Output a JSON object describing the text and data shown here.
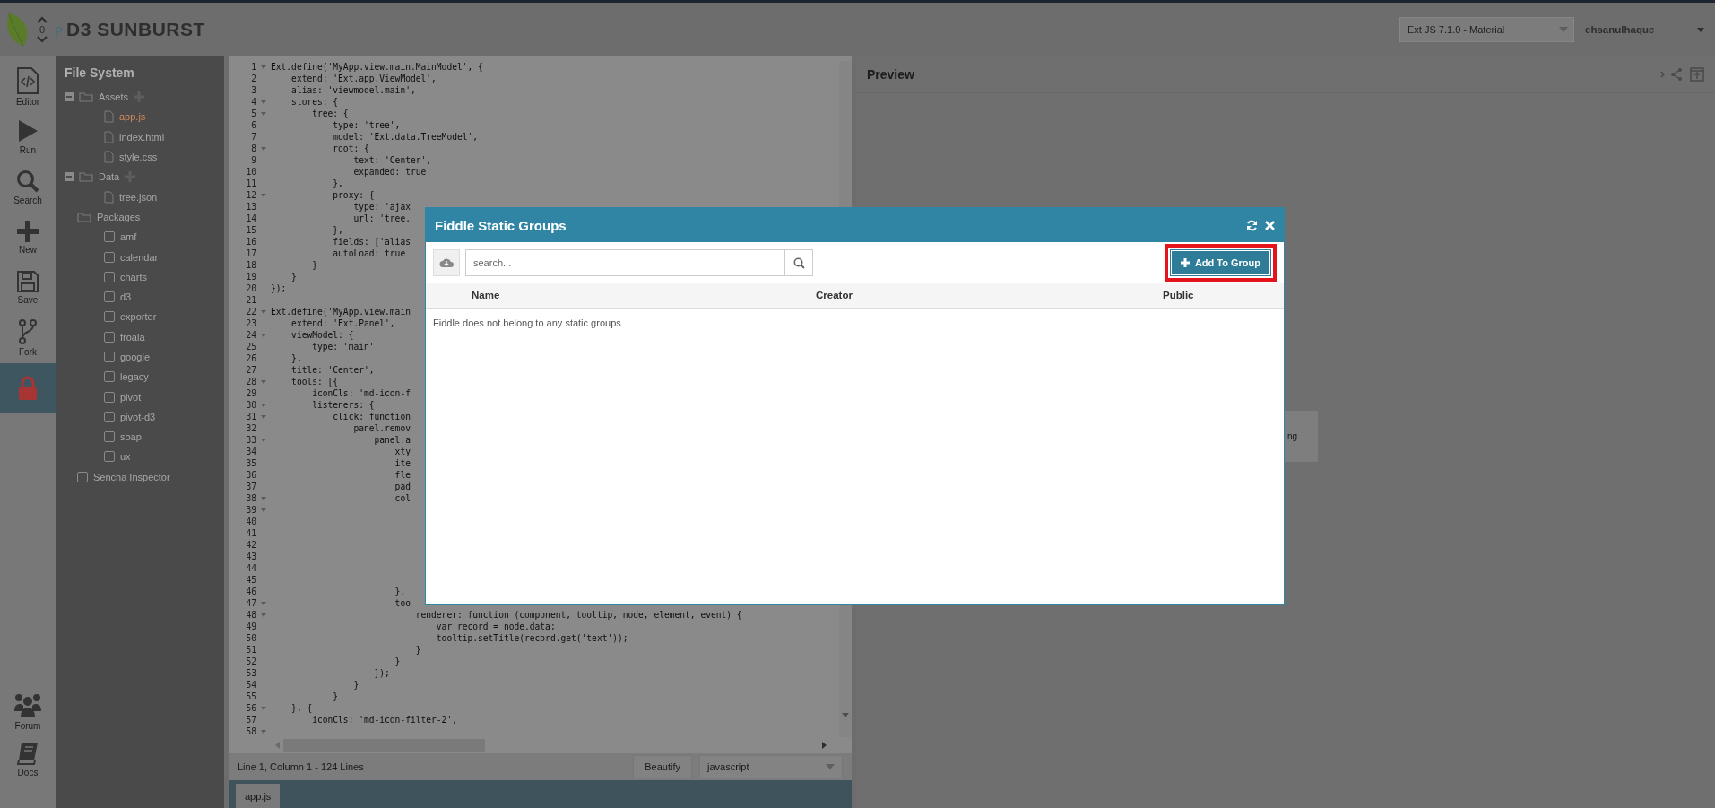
{
  "header": {
    "vote_count": "0",
    "title": "D3 SUNBURST",
    "framework_select": "Ext JS 7.1.0 - Material",
    "user": "ehsanulhaque"
  },
  "nav": {
    "items": [
      {
        "kind": "editor",
        "label": "Editor",
        "selected": false
      },
      {
        "kind": "run",
        "label": "Run",
        "selected": false
      },
      {
        "kind": "search",
        "label": "Search",
        "selected": false
      },
      {
        "kind": "new",
        "label": "New",
        "selected": false
      },
      {
        "kind": "save",
        "label": "Save",
        "selected": false
      },
      {
        "kind": "fork",
        "label": "Fork",
        "selected": false
      },
      {
        "kind": "lock",
        "selected": true
      }
    ],
    "bottom_items": [
      {
        "kind": "forum",
        "label": "Forum"
      },
      {
        "kind": "docs",
        "label": "Docs"
      }
    ]
  },
  "file_system": {
    "title": "File System",
    "tree": [
      {
        "kind": "folder",
        "label": "Assets",
        "expanded": true,
        "children": [
          {
            "kind": "file",
            "label": "app.js",
            "selected": true
          },
          {
            "kind": "file",
            "label": "index.html",
            "selected": false
          },
          {
            "kind": "file",
            "label": "style.css",
            "selected": false
          }
        ]
      },
      {
        "kind": "folder",
        "label": "Data",
        "expanded": true,
        "children": [
          {
            "kind": "file",
            "label": "tree.json",
            "selected": false
          }
        ]
      },
      {
        "kind": "group",
        "label": "Packages",
        "children": [
          {
            "kind": "package",
            "label": "amf",
            "checked": false
          },
          {
            "kind": "package",
            "label": "calendar",
            "checked": false
          },
          {
            "kind": "package",
            "label": "charts",
            "checked": false
          },
          {
            "kind": "package",
            "label": "d3",
            "checked": false
          },
          {
            "kind": "package",
            "label": "exporter",
            "checked": false
          },
          {
            "kind": "package",
            "label": "froala",
            "checked": false
          },
          {
            "kind": "package",
            "label": "google",
            "checked": false
          },
          {
            "kind": "package",
            "label": "legacy",
            "checked": false
          },
          {
            "kind": "package",
            "label": "pivot",
            "checked": false
          },
          {
            "kind": "package",
            "label": "pivot-d3",
            "checked": false
          },
          {
            "kind": "package",
            "label": "soap",
            "checked": false
          },
          {
            "kind": "package",
            "label": "ux",
            "checked": false
          }
        ]
      },
      {
        "kind": "package",
        "label": "Sencha Inspector",
        "checked": false
      }
    ]
  },
  "editor": {
    "lines": [
      {
        "number": "1",
        "code": "Ext.define('MyApp.view.main.MainModel', {",
        "foldable": true
      },
      {
        "number": "2",
        "code": "    extend: 'Ext.app.ViewModel',",
        "foldable": false
      },
      {
        "number": "3",
        "code": "    alias: 'viewmodel.main',",
        "foldable": false
      },
      {
        "number": "4",
        "code": "    stores: {",
        "foldable": true
      },
      {
        "number": "5",
        "code": "        tree: {",
        "foldable": true
      },
      {
        "number": "6",
        "code": "            type: 'tree',",
        "foldable": false
      },
      {
        "number": "7",
        "code": "            model: 'Ext.data.TreeModel',",
        "foldable": false
      },
      {
        "number": "8",
        "code": "            root: {",
        "foldable": true
      },
      {
        "number": "9",
        "code": "                text: 'Center',",
        "foldable": false
      },
      {
        "number": "10",
        "code": "                expanded: true",
        "foldable": false
      },
      {
        "number": "11",
        "code": "            },",
        "foldable": false
      },
      {
        "number": "12",
        "code": "            proxy: {",
        "foldable": true
      },
      {
        "number": "13",
        "code": "                type: 'ajax",
        "foldable": false
      },
      {
        "number": "14",
        "code": "                url: 'tree.",
        "foldable": false
      },
      {
        "number": "15",
        "code": "            },",
        "foldable": false
      },
      {
        "number": "16",
        "code": "            fields: ['alias",
        "foldable": false
      },
      {
        "number": "17",
        "code": "            autoLoad: true",
        "foldable": false
      },
      {
        "number": "18",
        "code": "        }",
        "foldable": false
      },
      {
        "number": "19",
        "code": "    }",
        "foldable": false
      },
      {
        "number": "20",
        "code": "});",
        "foldable": false
      },
      {
        "number": "21",
        "foldable": false
      },
      {
        "number": "22",
        "code": "Ext.define('MyApp.view.main",
        "foldable": true
      },
      {
        "number": "23",
        "code": "    extend: 'Ext.Panel',",
        "foldable": false
      },
      {
        "number": "24",
        "code": "    viewModel: {",
        "foldable": true
      },
      {
        "number": "25",
        "code": "        type: 'main'",
        "foldable": false
      },
      {
        "number": "26",
        "code": "    },",
        "foldable": false
      },
      {
        "number": "27",
        "code": "    title: 'Center',",
        "foldable": false
      },
      {
        "number": "28",
        "code": "    tools: [{",
        "foldable": true
      },
      {
        "number": "29",
        "code": "        iconCls: 'md-icon-f",
        "foldable": false
      },
      {
        "number": "30",
        "code": "        listeners: {",
        "foldable": true
      },
      {
        "number": "31",
        "code": "            click: function",
        "foldable": true
      },
      {
        "number": "32",
        "code": "                panel.remov",
        "foldable": false
      },
      {
        "number": "33",
        "code": "                    panel.a",
        "foldable": true
      },
      {
        "number": "34",
        "code": "                        xty",
        "foldable": false
      },
      {
        "number": "35",
        "code": "                        ite",
        "foldable": false
      },
      {
        "number": "36",
        "code": "                        fle",
        "foldable": false
      },
      {
        "number": "37",
        "code": "                        pad",
        "foldable": false
      },
      {
        "number": "38",
        "code": "                        col",
        "foldable": true
      },
      {
        "number": "39",
        "foldable": true
      },
      {
        "number": "40",
        "foldable": false
      },
      {
        "number": "41",
        "foldable": false
      },
      {
        "number": "42",
        "foldable": false
      },
      {
        "number": "43",
        "foldable": false
      },
      {
        "number": "44",
        "foldable": false
      },
      {
        "number": "45",
        "foldable": false
      },
      {
        "number": "46",
        "code": "                        },",
        "foldable": false
      },
      {
        "number": "47",
        "code": "                        too",
        "foldable": true
      },
      {
        "number": "48",
        "code": "                            renderer: function (component, tooltip, node, element, event) {",
        "foldable": true
      },
      {
        "number": "49",
        "code": "                                var record = node.data;",
        "foldable": false
      },
      {
        "number": "50",
        "code": "                                tooltip.setTitle(record.get('text'));",
        "foldable": false
      },
      {
        "number": "51",
        "code": "                            }",
        "foldable": false
      },
      {
        "number": "52",
        "code": "                        }",
        "foldable": false
      },
      {
        "number": "53",
        "code": "                    });",
        "foldable": false
      },
      {
        "number": "54",
        "code": "                }",
        "foldable": false
      },
      {
        "number": "55",
        "code": "            }",
        "foldable": false
      },
      {
        "number": "56",
        "code": "    }, {",
        "foldable": true
      },
      {
        "number": "57",
        "code": "        iconCls: 'md-icon-filter-2',",
        "foldable": false
      },
      {
        "number": "58",
        "foldable": true
      }
    ],
    "status": "Line 1, Column 1 - 124 Lines",
    "beautify_button": "Beautify",
    "language_select": "javascript",
    "tabs": [
      {
        "label": "app.js",
        "selected": true
      }
    ]
  },
  "preview": {
    "title": "Preview",
    "loading_text": "ng"
  },
  "dialog": {
    "title": "Fiddle Static Groups",
    "search_placeholder": "search...",
    "add_button": "Add To Group",
    "add_button_highlighted": true,
    "columns": [
      "Name",
      "Creator",
      "Public"
    ],
    "empty_text": "Fiddle does not belong to any static groups"
  }
}
